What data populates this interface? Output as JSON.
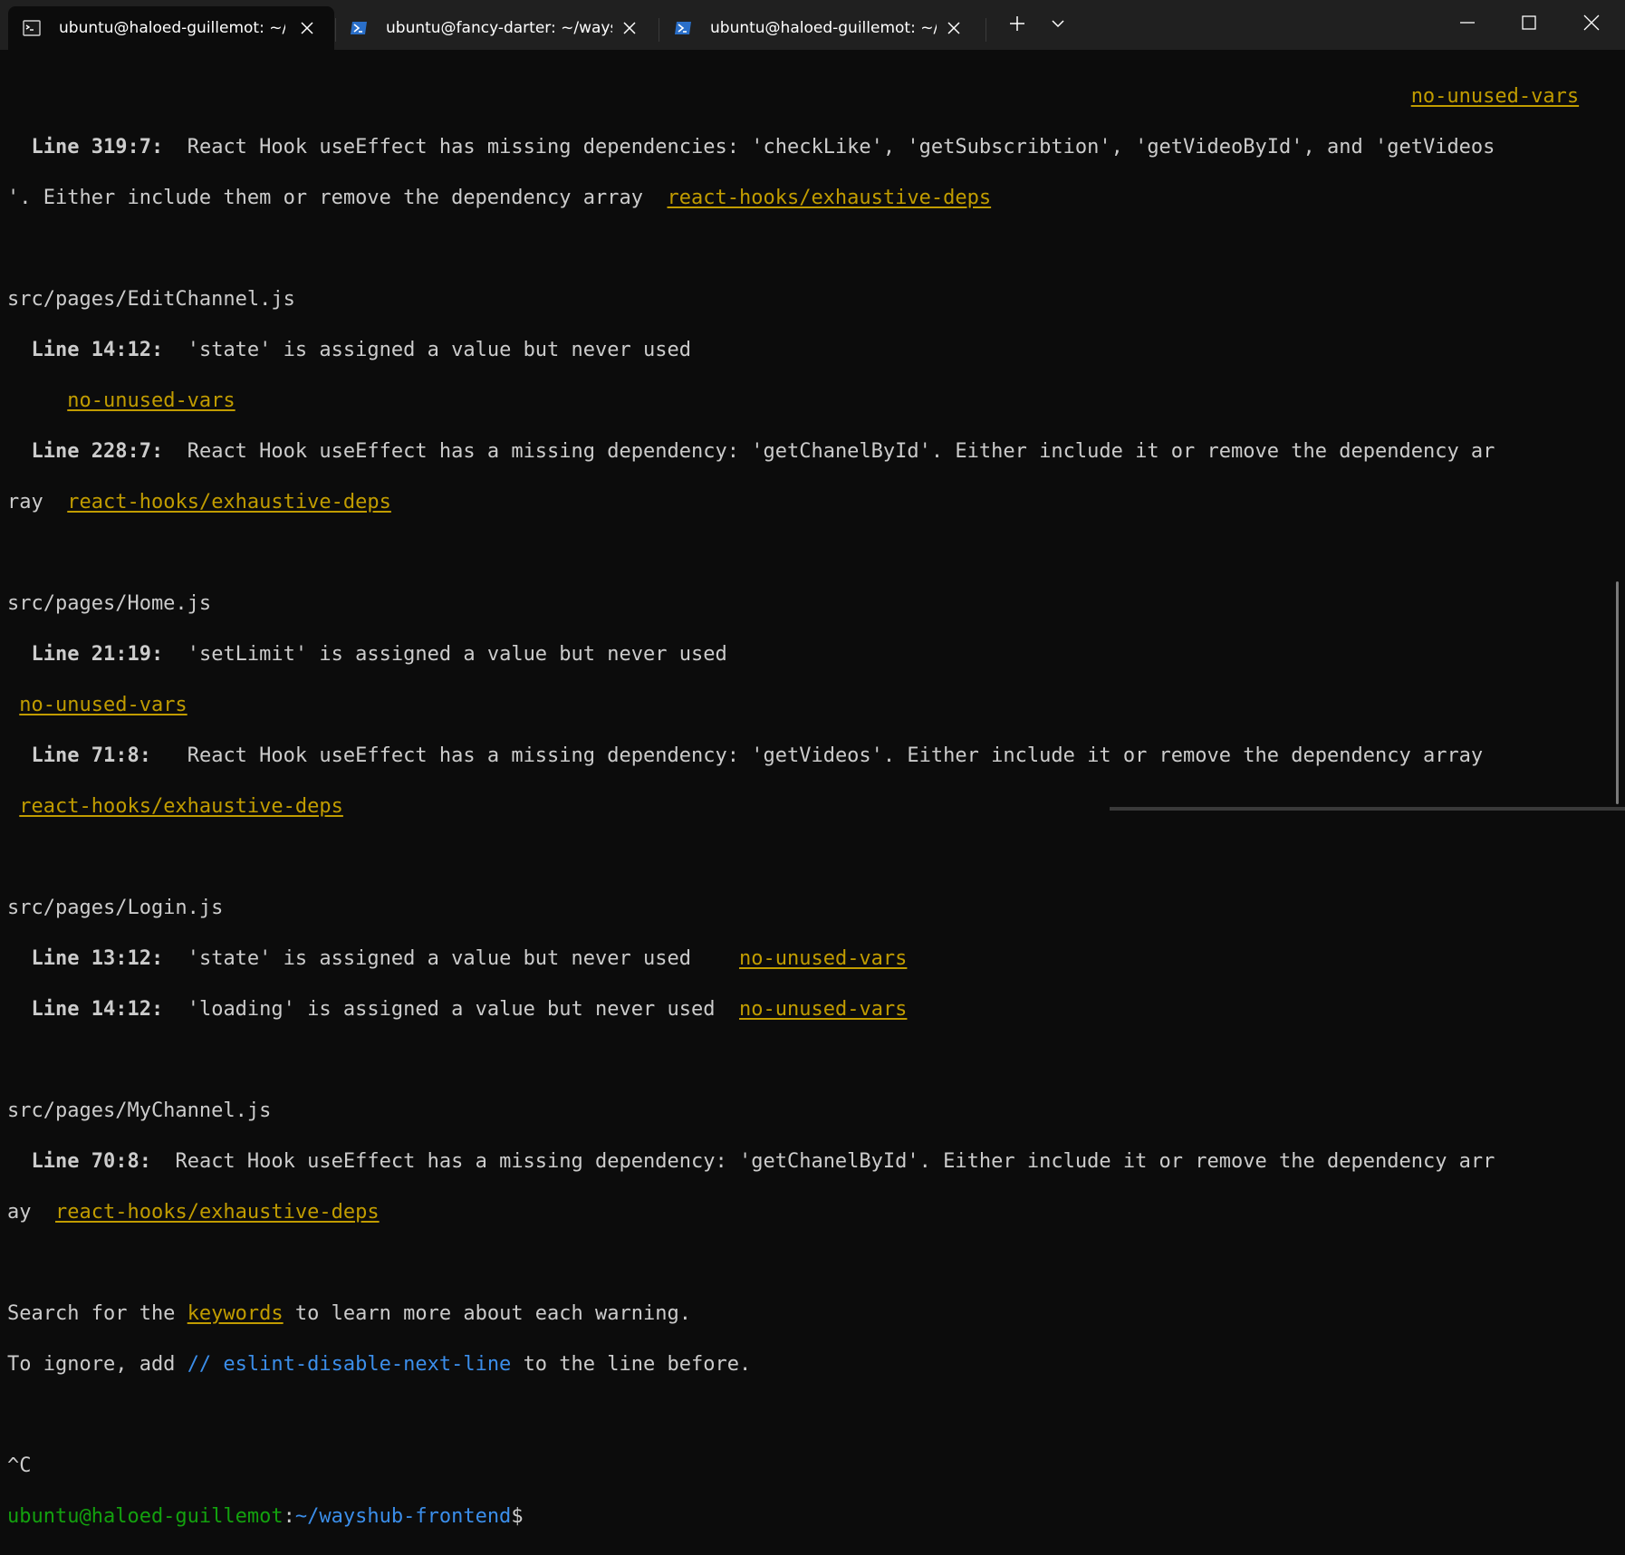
{
  "tabs": [
    {
      "title": "ubuntu@haloed-guillemot: ~/",
      "icon": "terminal-icon",
      "active": true
    },
    {
      "title": "ubuntu@fancy-darter: ~/ways",
      "icon": "powershell-icon",
      "active": false
    },
    {
      "title": "ubuntu@haloed-guillemot: ~/",
      "icon": "powershell-icon",
      "active": false
    }
  ],
  "colors": {
    "background": "#0c0c0c",
    "titlebar": "#202020",
    "text": "#cccccc",
    "warning_rule": "#c19c00",
    "comment_blue": "#3b8eea",
    "prompt_green": "#13a10e"
  },
  "terminal": {
    "l1": "no-unused-vars",
    "l2_label": "Line 319:7:",
    "l2_msg": "React Hook useEffect has missing dependencies: 'checkLike', 'getSubscribtion', 'getVideoById', and 'getVideos",
    "l3_msg": "'. Either include them or remove the dependency array",
    "l3_rule": "react-hooks/exhaustive-deps",
    "file1": "src/pages/EditChannel.js",
    "l5_label": "Line 14:12:",
    "l5_msg": "'state' is assigned a value but never used",
    "l6_rule": "no-unused-vars",
    "l7_label": "Line 228:7:",
    "l7_msg": "React Hook useEffect has a missing dependency: 'getChanelById'. Either include it or remove the dependency ar",
    "l8_msg": "ray",
    "l8_rule": "react-hooks/exhaustive-deps",
    "file2": "src/pages/Home.js",
    "l11_label": "Line 21:19:",
    "l11_msg": "'setLimit' is assigned a value but never used",
    "l12_rule": "no-unused-vars",
    "l13_label": "Line 71:8:",
    "l13_msg": "React Hook useEffect has a missing dependency: 'getVideos'. Either include it or remove the dependency array",
    "l14_rule": "react-hooks/exhaustive-deps",
    "file3": "src/pages/Login.js",
    "l17_label": "Line 13:12:",
    "l17_msg": "'state' is assigned a value but never used",
    "l17_rule": "no-unused-vars",
    "l18_label": "Line 14:12:",
    "l18_msg": "'loading' is assigned a value but never used",
    "l18_rule": "no-unused-vars",
    "file4": "src/pages/MyChannel.js",
    "l21_label": "Line 70:8:",
    "l21_msg": "React Hook useEffect has a missing dependency: 'getChanelById'. Either include it or remove the dependency arr",
    "l22_msg": "ay",
    "l22_rule": "react-hooks/exhaustive-deps",
    "search_pre": "Search for the",
    "search_kw": "keywords",
    "search_post": "to learn more about each warning.",
    "ignore_pre": "To ignore, add",
    "ignore_code": "// eslint-disable-next-line",
    "ignore_post": "to the line before.",
    "ctrl_c": "^C",
    "prompt_user": "ubuntu@haloed-guillemot",
    "prompt_colon": ":",
    "prompt_path": "~/wayshub-frontend",
    "prompt_sign": "$"
  }
}
